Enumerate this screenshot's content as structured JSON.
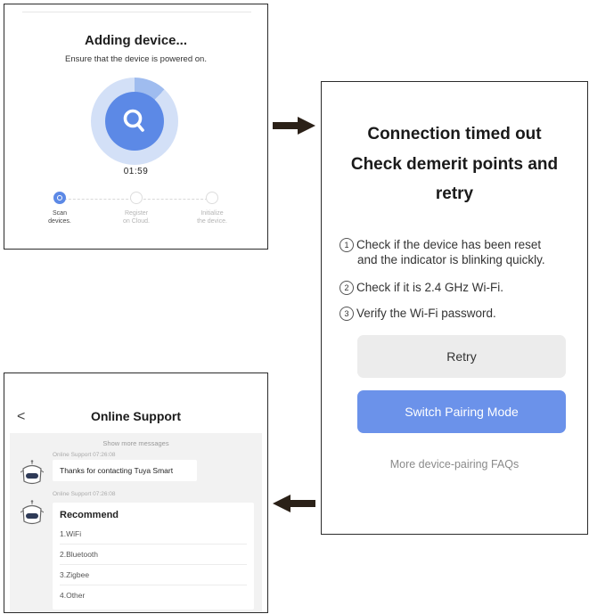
{
  "adding": {
    "title": "Adding device...",
    "subtitle": "Ensure that the device is powered on.",
    "progress_fraction": 0.12,
    "timer": "01:59",
    "steps": [
      {
        "label": "Scan\ndevices.",
        "state": "active"
      },
      {
        "label": "Register\non Cloud.",
        "state": "pending"
      },
      {
        "label": "Initialize\nthe device.",
        "state": "pending"
      }
    ]
  },
  "timeout": {
    "title_line1": "Connection timed out",
    "title_line2": "Check demerit points and",
    "title_line3": "retry",
    "tips": [
      {
        "num": "1",
        "line1": "Check if the device has been reset",
        "line2": "and the indicator is blinking quickly."
      },
      {
        "num": "2",
        "line1": "Check if it is 2.4 GHz Wi-Fi.",
        "line2": ""
      },
      {
        "num": "3",
        "line1": "Verify the Wi-Fi password.",
        "line2": ""
      }
    ],
    "retry_label": "Retry",
    "switch_label": "Switch Pairing Mode",
    "faq_label": "More device-pairing FAQs"
  },
  "support": {
    "back_glyph": "<",
    "title": "Online Support",
    "show_more": "Show more messages",
    "msg1_meta": "Online Support  07:26:08",
    "msg1_text": "Thanks for contacting Tuya Smart",
    "msg2_meta": "Online Support  07:26:08",
    "recommend_title": "Recommend",
    "recommend_items": [
      "1.WiFi",
      "2.Bluetooth",
      "3.Zigbee",
      "4.Other"
    ]
  },
  "colors": {
    "accent": "#5c89e6",
    "switch_button": "#6b92ea",
    "ring_light": "#d3e0f7",
    "arrow": "#2b2118"
  },
  "icons": {
    "scan": "search-icon",
    "register": "cloud-icon",
    "initialize": "gear-icon",
    "arrow_right": "arrow-right-icon",
    "arrow_left": "arrow-left-icon",
    "avatar": "robot-avatar-icon"
  }
}
